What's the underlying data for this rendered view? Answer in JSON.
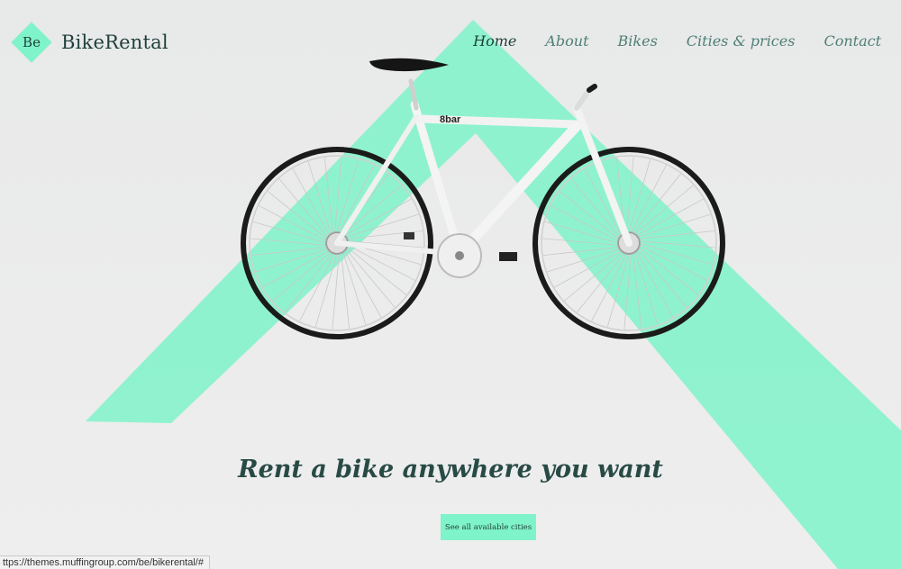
{
  "brand": {
    "logo_mark": "Be",
    "name": "BikeRental",
    "accent_color": "#7ff3c9",
    "text_color": "#1f3f3a"
  },
  "nav": {
    "items": [
      {
        "label": "Home",
        "active": true
      },
      {
        "label": "About",
        "active": false
      },
      {
        "label": "Bikes",
        "active": false
      },
      {
        "label": "Cities & prices",
        "active": false
      },
      {
        "label": "Contact",
        "active": false
      }
    ]
  },
  "hero": {
    "bike_brand": "8bar",
    "title": "Rent a bike anywhere you want",
    "cta_label": "See all available cities"
  },
  "status_bar": {
    "url": "ttps://themes.muffingroup.com/be/bikerental/#"
  }
}
